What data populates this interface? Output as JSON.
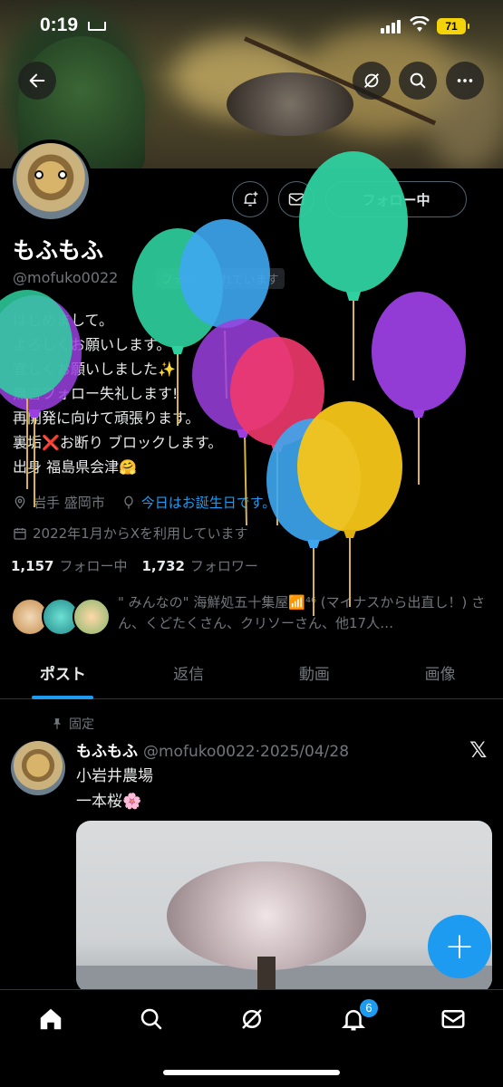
{
  "status": {
    "time": "0:19",
    "battery": "71"
  },
  "profile": {
    "name": "もふもふ",
    "handle": "@mofuko0022",
    "follows_you": "フォローされています",
    "follow_button": "フォロー中",
    "bio": [
      "はじめまして。",
      "よろしくお願いします。",
      "宜しくお願いしました✨",
      "無言フォロー失礼します!",
      "再開発に向けて頑張ります。",
      "裏垢❌お断り ブロックします。",
      "出身 福島県会津🤗"
    ],
    "location": "岩手 盛岡市",
    "birthday": "今日はお誕生日です。",
    "joined": "2022年1月からXを利用しています",
    "following_count": "1,157",
    "following_label": "フォロー中",
    "followers_count": "1,732",
    "followers_label": "フォロワー",
    "followed_by": "\" みんなの\" 海鮮処五十集屋📶⁴⁶ (マイナスから出直し！) さん、くどたくさん、クリソーさん、他17人…"
  },
  "tabs": [
    "ポスト",
    "返信",
    "動画",
    "画像"
  ],
  "post": {
    "pinned_label": "固定",
    "name": "もふもふ",
    "handle": "@mofuko0022",
    "date": "2025/04/28",
    "lines": [
      "小岩井農場",
      "一本桜🌸"
    ]
  },
  "fab_label": "+",
  "notifications_badge": "6",
  "icons": {
    "back": "back-arrow-icon",
    "grok": "grok-icon",
    "search": "search-icon",
    "more": "more-icon",
    "bell_add": "notification-add-icon",
    "message": "message-icon",
    "location": "location-icon",
    "birthday": "balloon-icon",
    "calendar": "calendar-icon",
    "pin": "pin-icon",
    "x": "x-logo-icon",
    "home": "home-icon",
    "explore": "search-icon",
    "ai": "grok-icon",
    "notifications": "bell-icon",
    "mail": "mail-icon"
  },
  "colors": {
    "accent": "#1d9bf0",
    "background": "#000000",
    "battery": "#f5d30b"
  },
  "balloons": [
    "#2fd1a0",
    "#3ea7f0",
    "#9b3fe0",
    "#f0386b",
    "#f5c518",
    "#2fd1a0"
  ]
}
